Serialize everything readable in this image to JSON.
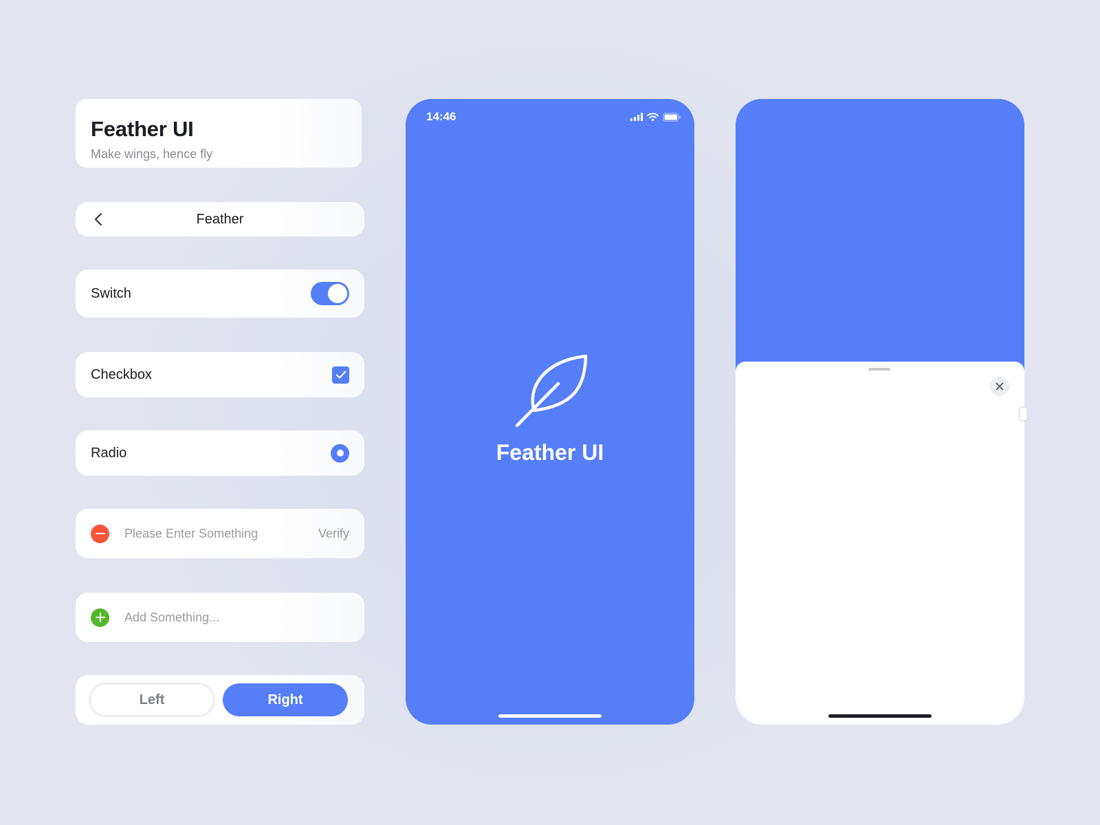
{
  "left_panel": {
    "title_card": {
      "title": "Feather UI",
      "subtitle": "Make wings, hence fly"
    },
    "nav_bar": {
      "title": "Feather",
      "back_icon": "chevron-left-icon"
    },
    "switch_row": {
      "label": "Switch",
      "checked": true
    },
    "checkbox_row": {
      "label": "Checkbox",
      "checked": true
    },
    "radio_row": {
      "label": "Radio",
      "selected": true
    },
    "input_row": {
      "placeholder": "Please Enter Something",
      "value": "",
      "action": "Verify",
      "icon": "minus-circle-icon"
    },
    "add_row": {
      "placeholder": "Add Something...",
      "value": "",
      "icon": "plus-circle-icon"
    },
    "buttons": {
      "left": "Left",
      "right": "Right"
    }
  },
  "splash_screen": {
    "status_time": "14:46",
    "status_icons": [
      "signal-icon",
      "wifi-icon",
      "battery-icon"
    ],
    "logo_icon": "feather-leaf-icon",
    "title": "Feather UI"
  },
  "sheet_screen": {
    "close_icon": "close-icon"
  },
  "colors": {
    "primary": "#557ef8",
    "danger": "#f5553a",
    "success": "#55b82a",
    "background": "#dde1ee"
  }
}
